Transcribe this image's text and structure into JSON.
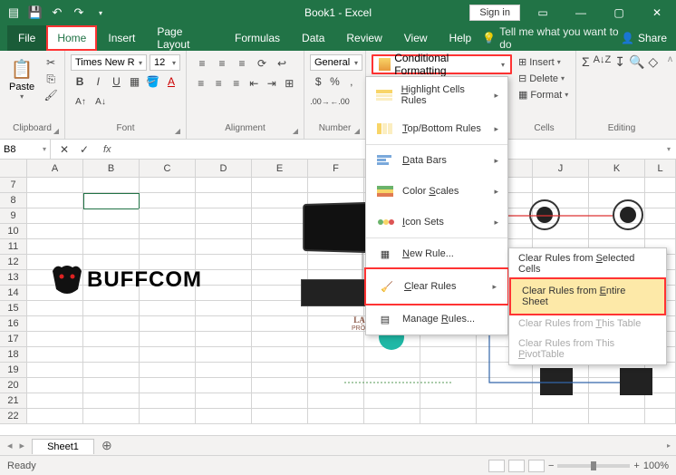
{
  "titlebar": {
    "title": "Book1 - Excel",
    "signin": "Sign in"
  },
  "tabs": {
    "file": "File",
    "home": "Home",
    "insert": "Insert",
    "pagelayout": "Page Layout",
    "formulas": "Formulas",
    "data": "Data",
    "review": "Review",
    "view": "View",
    "help": "Help",
    "tell": "Tell me what you want to do",
    "share": "Share"
  },
  "ribbon": {
    "clipboard": {
      "paste": "Paste",
      "label": "Clipboard"
    },
    "font": {
      "name": "Times New R",
      "size": "12",
      "label": "Font"
    },
    "alignment": {
      "label": "Alignment"
    },
    "number": {
      "format": "General",
      "label": "Number"
    },
    "styles": {
      "condfmt": "Conditional Formatting"
    },
    "cells": {
      "insert": "Insert",
      "delete": "Delete",
      "format": "Format",
      "label": "Cells"
    },
    "editing": {
      "label": "Editing"
    }
  },
  "namebox": "B8",
  "columns": [
    "A",
    "B",
    "C",
    "D",
    "E",
    "F",
    "",
    "",
    "",
    "J",
    "K",
    "L"
  ],
  "rows_start": 7,
  "rows_end": 22,
  "selected_cell": {
    "col": 1,
    "rowidx": 1
  },
  "cf_menu": {
    "highlight": "Highlight Cells Rules",
    "topbottom": "Top/Bottom Rules",
    "databars": "Data Bars",
    "colorscales": "Color Scales",
    "iconsets": "Icon Sets",
    "newrule": "New Rule...",
    "clearrules": "Clear Rules",
    "managerules": "Manage Rules..."
  },
  "clear_submenu": {
    "selected": "Clear Rules from Selected Cells",
    "sheet": "Clear Rules from Entire Sheet",
    "table": "Clear Rules from This Table",
    "pivot": "Clear Rules from This PivotTable"
  },
  "sheet": {
    "name": "Sheet1"
  },
  "status": {
    "ready": "Ready",
    "zoom": "100%"
  },
  "overlay": {
    "buffcom": "BUFFCOM",
    "lacviet1": "LẠC VIỆT AUDIO",
    "lacviet2": "PRO SOUND / KTV & PA"
  }
}
